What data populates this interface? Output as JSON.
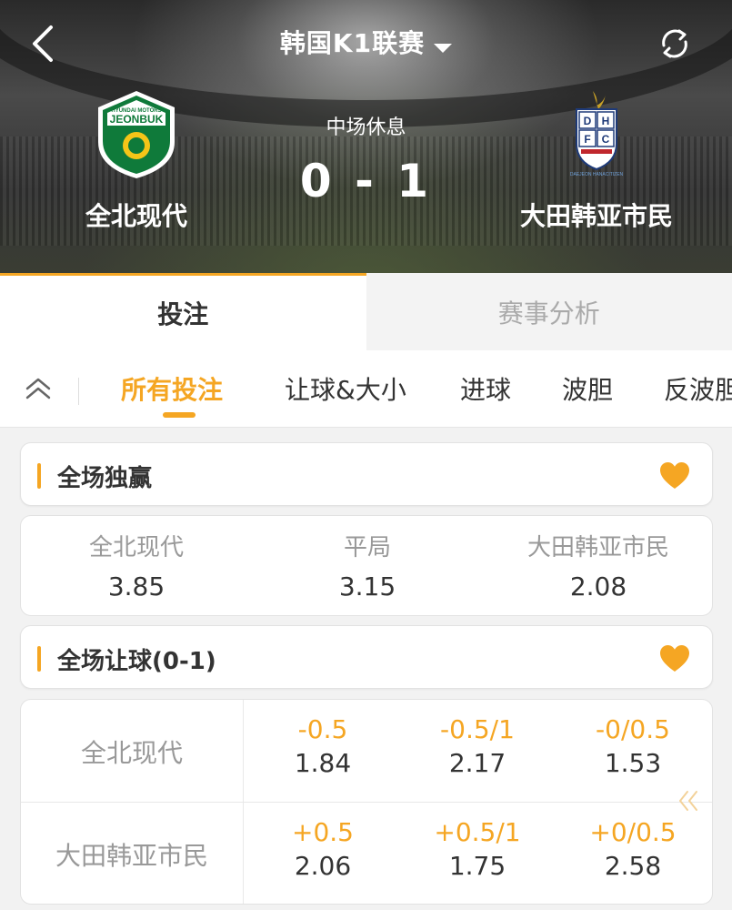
{
  "header": {
    "league_title": "韩国K1联赛",
    "status": "中场休息",
    "score": "0 - 1",
    "home": {
      "name": "全北现代",
      "logo_text": "JEONBUK",
      "logo_subtext": "HYUNDAI MOTORS"
    },
    "away": {
      "name": "大田韩亚市民",
      "logo_letters": [
        "D",
        "H",
        "F",
        "C"
      ],
      "logo_subtext": "DAEJEON HANACITIZEN"
    }
  },
  "icons": {
    "back": "back-arrow-icon",
    "dropdown": "caret-down-icon",
    "refresh": "refresh-icon",
    "collapse": "chevron-up-double-icon",
    "favorite": "heart-icon",
    "scroll": "chevron-left-double-icon"
  },
  "main_tabs": [
    {
      "label": "投注",
      "active": true
    },
    {
      "label": "赛事分析",
      "active": false
    }
  ],
  "filters": [
    {
      "label": "所有投注",
      "active": true
    },
    {
      "label": "让球&大小",
      "active": false
    },
    {
      "label": "进球",
      "active": false
    },
    {
      "label": "波胆",
      "active": false
    },
    {
      "label": "反波胆",
      "active": false
    }
  ],
  "markets": [
    {
      "title": "全场独赢",
      "outcomes": [
        {
          "label": "全北现代",
          "odds": "3.85"
        },
        {
          "label": "平局",
          "odds": "3.15"
        },
        {
          "label": "大田韩亚市民",
          "odds": "2.08"
        }
      ]
    },
    {
      "title": "全场让球(0-1)",
      "rows": [
        {
          "team": "全北现代",
          "cells": [
            {
              "line": "-0.5",
              "odds": "1.84"
            },
            {
              "line": "-0.5/1",
              "odds": "2.17"
            },
            {
              "line": "-0/0.5",
              "odds": "1.53"
            }
          ]
        },
        {
          "team": "大田韩亚市民",
          "cells": [
            {
              "line": "+0.5",
              "odds": "2.06"
            },
            {
              "line": "+0.5/1",
              "odds": "1.75"
            },
            {
              "line": "+0/0.5",
              "odds": "2.58"
            }
          ]
        }
      ]
    }
  ],
  "colors": {
    "accent": "#f5a623",
    "text": "#333333",
    "muted": "#999999",
    "background": "#f2f2f2"
  }
}
